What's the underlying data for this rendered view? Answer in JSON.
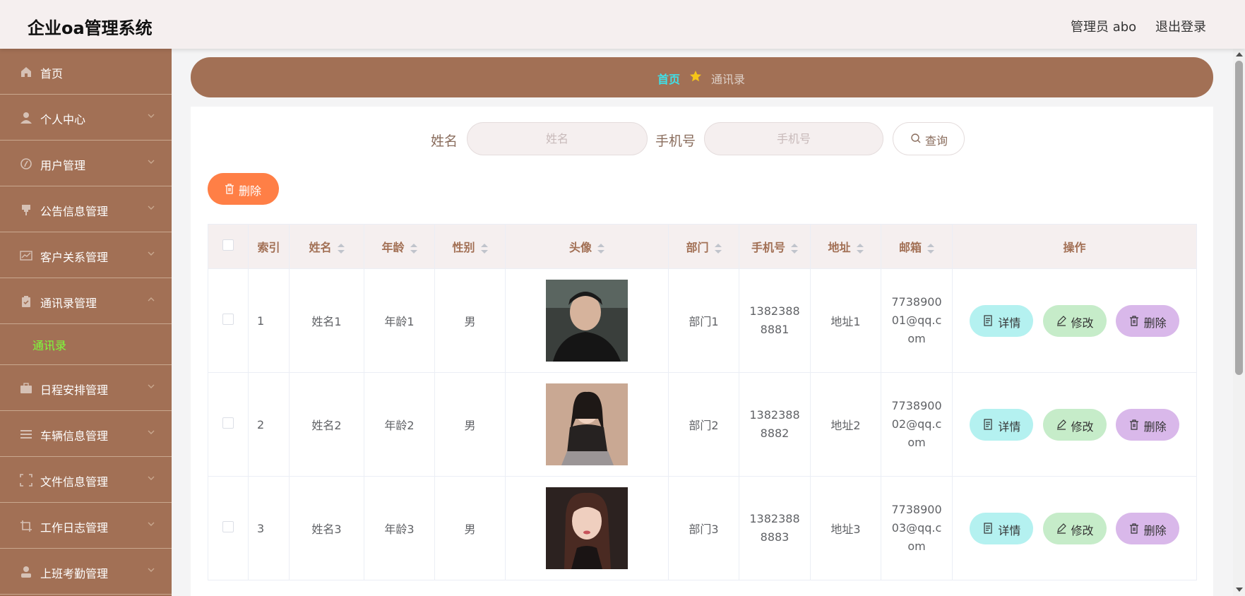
{
  "app": {
    "title": "企业oa管理系统",
    "user": "管理员 abo",
    "logout": "退出登录"
  },
  "sidebar": {
    "items": [
      {
        "label": "首页",
        "icon": "home-icon"
      },
      {
        "label": "个人中心",
        "icon": "user-icon"
      },
      {
        "label": "用户管理",
        "icon": "compass-icon"
      },
      {
        "label": "公告信息管理",
        "icon": "notice-icon"
      },
      {
        "label": "客户关系管理",
        "icon": "chart-icon"
      },
      {
        "label": "通讯录管理",
        "icon": "clipboard-icon"
      },
      {
        "label": "日程安排管理",
        "icon": "briefcase-icon"
      },
      {
        "label": "车辆信息管理",
        "icon": "list-icon"
      },
      {
        "label": "文件信息管理",
        "icon": "frame-icon"
      },
      {
        "label": "工作日志管理",
        "icon": "crop-icon"
      },
      {
        "label": "上班考勤管理",
        "icon": "person-icon"
      }
    ],
    "sub_items": [
      {
        "label": "通讯录"
      }
    ]
  },
  "breadcrumb": {
    "home": "首页",
    "current": "通讯录"
  },
  "search": {
    "name_label": "姓名",
    "name_placeholder": "姓名",
    "phone_label": "手机号",
    "phone_placeholder": "手机号",
    "query_label": "查询"
  },
  "actions": {
    "delete_label": "删除"
  },
  "table": {
    "headers": {
      "index": "索引",
      "name": "姓名",
      "age": "年龄",
      "gender": "性别",
      "avatar": "头像",
      "dept": "部门",
      "phone": "手机号",
      "address": "地址",
      "email": "邮箱",
      "ops": "操作"
    },
    "rows": [
      {
        "index": "1",
        "name": "姓名1",
        "age": "年龄1",
        "gender": "男",
        "dept": "部门1",
        "phone": "13823888881",
        "address": "地址1",
        "email": "773890001@qq.com"
      },
      {
        "index": "2",
        "name": "姓名2",
        "age": "年龄2",
        "gender": "男",
        "dept": "部门2",
        "phone": "13823888882",
        "address": "地址2",
        "email": "773890002@qq.com"
      },
      {
        "index": "3",
        "name": "姓名3",
        "age": "年龄3",
        "gender": "男",
        "dept": "部门3",
        "phone": "13823888883",
        "address": "地址3",
        "email": "773890003@qq.com"
      }
    ],
    "ops": {
      "detail": "详情",
      "edit": "修改",
      "delete": "删除"
    }
  },
  "colors": {
    "brand": "#a27055",
    "header_bg": "#f5efef",
    "active_sub": "#7dff3a",
    "breadcrumb_home": "#3fe0e8",
    "delete_btn": "#ff7f46",
    "detail_btn": "#b4f1f0",
    "edit_btn": "#c6ecc9",
    "row_delete_btn": "#d9b8ea"
  }
}
